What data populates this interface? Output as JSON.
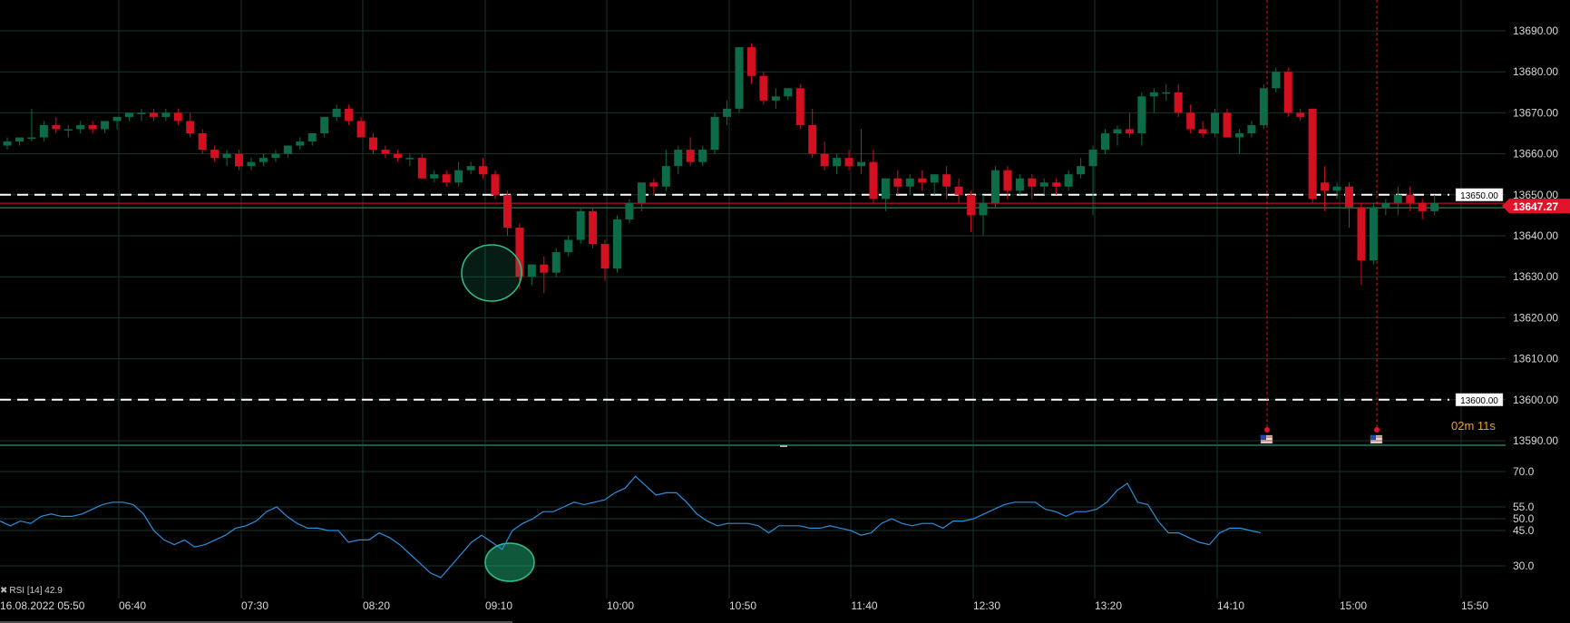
{
  "chart_data": {
    "type": "candlestick",
    "price_axis": {
      "ticks": [
        "13690.00",
        "13680.00",
        "13670.00",
        "13660.00",
        "13650.00",
        "13640.00",
        "13630.00",
        "13620.00",
        "13610.00",
        "13600.00",
        "13590.00"
      ],
      "tick_values": [
        13690,
        13680,
        13670,
        13660,
        13650,
        13640,
        13630,
        13620,
        13610,
        13600,
        13590
      ]
    },
    "time_axis": {
      "ticks": [
        "16.08.2022 05:50",
        "06:40",
        "07:30",
        "08:20",
        "09:10",
        "10:00",
        "10:50",
        "11:40",
        "12:30",
        "13:20",
        "14:10",
        "15:00",
        "15:50"
      ]
    },
    "current_price": {
      "label": "13647.27",
      "value": 13647.27,
      "color": "#e0142a"
    },
    "horizontal_lines": [
      {
        "label": "13650.00",
        "value": 13650
      },
      {
        "label": "13600.00",
        "value": 13600
      }
    ],
    "countdown": "02m 11s",
    "candles": [
      [
        13662,
        13664,
        13661,
        13663
      ],
      [
        13663,
        13664,
        13662,
        13664
      ],
      [
        13664,
        13671,
        13663,
        13664
      ],
      [
        13664,
        13668,
        13663,
        13667
      ],
      [
        13667,
        13669,
        13665,
        13666
      ],
      [
        13666,
        13667,
        13664,
        13666
      ],
      [
        13666,
        13668,
        13665,
        13667
      ],
      [
        13667,
        13668,
        13665,
        13666
      ],
      [
        13666,
        13667,
        13665,
        13668
      ],
      [
        13668,
        13669,
        13666,
        13669
      ],
      [
        13669,
        13670,
        13668,
        13670
      ],
      [
        13670,
        13671,
        13668,
        13670
      ],
      [
        13670,
        13671,
        13668,
        13669
      ],
      [
        13669,
        13671,
        13668,
        13670
      ],
      [
        13670,
        13671,
        13667,
        13668
      ],
      [
        13668,
        13670,
        13664,
        13665
      ],
      [
        13665,
        13666,
        13660,
        13661
      ],
      [
        13661,
        13662,
        13658,
        13659
      ],
      [
        13659,
        13661,
        13657,
        13660
      ],
      [
        13660,
        13661,
        13656,
        13657
      ],
      [
        13657,
        13659,
        13656,
        13658
      ],
      [
        13658,
        13660,
        13657,
        13659
      ],
      [
        13659,
        13661,
        13658,
        13660
      ],
      [
        13660,
        13662,
        13659,
        13662
      ],
      [
        13662,
        13664,
        13661,
        13663
      ],
      [
        13663,
        13665,
        13662,
        13665
      ],
      [
        13665,
        13669,
        13664,
        13669
      ],
      [
        13669,
        13672,
        13668,
        13671
      ],
      [
        13671,
        13672,
        13667,
        13668
      ],
      [
        13668,
        13669,
        13664,
        13664
      ],
      [
        13664,
        13665,
        13660,
        13661
      ],
      [
        13661,
        13662,
        13659,
        13660
      ],
      [
        13660,
        13661,
        13658,
        13659
      ],
      [
        13659,
        13660,
        13657,
        13659
      ],
      [
        13659,
        13660,
        13654,
        13654
      ],
      [
        13654,
        13656,
        13653,
        13655
      ],
      [
        13655,
        13656,
        13652,
        13653
      ],
      [
        13653,
        13658,
        13652,
        13656
      ],
      [
        13656,
        13658,
        13655,
        13657
      ],
      [
        13657,
        13659,
        13654,
        13655
      ],
      [
        13655,
        13656,
        13649,
        13650
      ],
      [
        13650,
        13651,
        13640,
        13642
      ],
      [
        13642,
        13643,
        13627,
        13630
      ],
      [
        13630,
        13633,
        13628,
        13633
      ],
      [
        13633,
        13635,
        13626,
        13631
      ],
      [
        13631,
        13637,
        13630,
        13636
      ],
      [
        13636,
        13640,
        13635,
        13639
      ],
      [
        13639,
        13647,
        13638,
        13646
      ],
      [
        13646,
        13647,
        13637,
        13638
      ],
      [
        13638,
        13639,
        13629,
        13632
      ],
      [
        13632,
        13645,
        13631,
        13644
      ],
      [
        13644,
        13649,
        13643,
        13648
      ],
      [
        13648,
        13653,
        13646,
        13653
      ],
      [
        13653,
        13654,
        13650,
        13652
      ],
      [
        13652,
        13661,
        13651,
        13657
      ],
      [
        13657,
        13662,
        13655,
        13661
      ],
      [
        13661,
        13664,
        13657,
        13658
      ],
      [
        13658,
        13662,
        13657,
        13661
      ],
      [
        13661,
        13670,
        13660,
        13669
      ],
      [
        13669,
        13673,
        13667,
        13671
      ],
      [
        13671,
        13686,
        13670,
        13686
      ],
      [
        13686,
        13687,
        13677,
        13679
      ],
      [
        13679,
        13680,
        13672,
        13673
      ],
      [
        13673,
        13676,
        13671,
        13674
      ],
      [
        13674,
        13676,
        13673,
        13676
      ],
      [
        13676,
        13677,
        13666,
        13667
      ],
      [
        13667,
        13671,
        13659,
        13660
      ],
      [
        13660,
        13663,
        13656,
        13657
      ],
      [
        13657,
        13660,
        13655,
        13659
      ],
      [
        13659,
        13661,
        13656,
        13657
      ],
      [
        13657,
        13666,
        13655,
        13658
      ],
      [
        13658,
        13661,
        13648,
        13649
      ],
      [
        13649,
        13654,
        13646,
        13654
      ],
      [
        13654,
        13656,
        13650,
        13652
      ],
      [
        13652,
        13655,
        13650,
        13654
      ],
      [
        13654,
        13656,
        13651,
        13653
      ],
      [
        13653,
        13655,
        13650,
        13655
      ],
      [
        13655,
        13657,
        13649,
        13652
      ],
      [
        13652,
        13654,
        13648,
        13650
      ],
      [
        13650,
        13651,
        13641,
        13645
      ],
      [
        13645,
        13650,
        13640,
        13648
      ],
      [
        13648,
        13657,
        13647,
        13656
      ],
      [
        13656,
        13657,
        13649,
        13651
      ],
      [
        13651,
        13655,
        13650,
        13654
      ],
      [
        13654,
        13655,
        13649,
        13652
      ],
      [
        13652,
        13654,
        13650,
        13653
      ],
      [
        13653,
        13654,
        13650,
        13652
      ],
      [
        13652,
        13656,
        13651,
        13655
      ],
      [
        13655,
        13659,
        13654,
        13657
      ],
      [
        13657,
        13662,
        13645,
        13661
      ],
      [
        13661,
        13666,
        13660,
        13665
      ],
      [
        13665,
        13667,
        13662,
        13666
      ],
      [
        13666,
        13670,
        13664,
        13665
      ],
      [
        13665,
        13675,
        13662,
        13674
      ],
      [
        13674,
        13676,
        13670,
        13675
      ],
      [
        13675,
        13677,
        13673,
        13675
      ],
      [
        13675,
        13677,
        13669,
        13670
      ],
      [
        13670,
        13672,
        13665,
        13666
      ],
      [
        13666,
        13668,
        13664,
        13665
      ],
      [
        13665,
        13671,
        13664,
        13670
      ],
      [
        13670,
        13671,
        13664,
        13664
      ],
      [
        13664,
        13666,
        13660,
        13665
      ],
      [
        13665,
        13668,
        13664,
        13667
      ],
      [
        13667,
        13677,
        13666,
        13676
      ],
      [
        13676,
        13681,
        13675,
        13680
      ],
      [
        13680,
        13681,
        13669,
        13670
      ],
      [
        13670,
        13671,
        13668,
        13669
      ],
      [
        13671,
        13671,
        13648,
        13649
      ],
      [
        13653,
        13657,
        13646,
        13651
      ],
      [
        13651,
        13653,
        13649,
        13652
      ],
      [
        13652,
        13653,
        13642,
        13647
      ],
      [
        13647,
        13648,
        13628,
        13634
      ],
      [
        13634,
        13648,
        13633,
        13647
      ],
      [
        13647,
        13649,
        13645,
        13648
      ],
      [
        13648,
        13652,
        13645,
        13650
      ],
      [
        13650,
        13652,
        13646,
        13648
      ],
      [
        13648,
        13649,
        13644,
        13646
      ],
      [
        13646,
        13650,
        13645,
        13648
      ]
    ],
    "rsi": {
      "legend": "RSI [14] 42.9",
      "ticks": [
        "70.0",
        "55.0",
        "50.0",
        "45.0",
        "30.0"
      ],
      "tick_values": [
        70,
        55,
        50,
        45,
        30
      ],
      "values": [
        49,
        47,
        49,
        48,
        51,
        52,
        51,
        51,
        52,
        54,
        56,
        57,
        57,
        56,
        52,
        45,
        41,
        39,
        41,
        38,
        39,
        41,
        43,
        46,
        47,
        49,
        53,
        55,
        51,
        48,
        46,
        46,
        45,
        45,
        40,
        41,
        41,
        44,
        42,
        39,
        35,
        31,
        27,
        25,
        30,
        35,
        40,
        43,
        40,
        37,
        45,
        48,
        50,
        53,
        53,
        55,
        57,
        56,
        57,
        58,
        61,
        63,
        68,
        64,
        60,
        61,
        61,
        57,
        52,
        49,
        47,
        48,
        48,
        48,
        47,
        44,
        47,
        47,
        47,
        46,
        46,
        47,
        46,
        45,
        43,
        44,
        48,
        50,
        48,
        47,
        48,
        48,
        46,
        49,
        49,
        50,
        52,
        54,
        56,
        57,
        57,
        57,
        54,
        53,
        51,
        53,
        53,
        54,
        57,
        62,
        65,
        57,
        56,
        49,
        44,
        44,
        42,
        40,
        39,
        44,
        46,
        46,
        45,
        44
      ]
    }
  }
}
